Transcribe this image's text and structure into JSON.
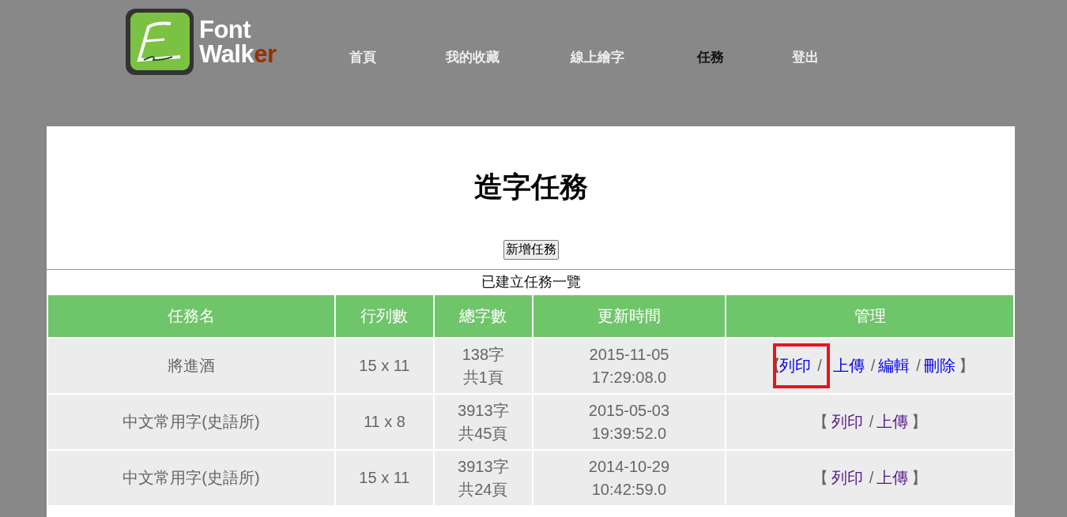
{
  "logo": {
    "line1": "Font",
    "line2": "Walk",
    "line2_accent": "er"
  },
  "nav": [
    {
      "label": "首頁",
      "selected": false
    },
    {
      "label": "我的收藏",
      "selected": false
    },
    {
      "label": "線上繪字",
      "selected": false
    },
    {
      "label": "任務",
      "selected": true
    },
    {
      "label": "登出",
      "selected": false
    }
  ],
  "page_title": "造字任務",
  "add_button": "新增任務",
  "table": {
    "caption": "已建立任務一覽",
    "columns": [
      "任務名",
      "行列數",
      "總字數",
      "更新時間",
      "管理"
    ],
    "rows": [
      {
        "name": "將進酒",
        "grid": "15 x 11",
        "count": [
          "138字",
          "共1頁"
        ],
        "updated": [
          "2015-11-05",
          "17:29:08.0"
        ],
        "open": "【",
        "close": "】",
        "separator": "/",
        "actions": [
          {
            "label": "列印",
            "visited": false,
            "highlighted": true
          },
          {
            "label": "上傳",
            "visited": false,
            "highlighted": false
          },
          {
            "label": "編輯",
            "visited": false,
            "highlighted": false
          },
          {
            "label": "刪除",
            "visited": false,
            "highlighted": false
          }
        ]
      },
      {
        "name": "中文常用字(史語所)",
        "grid": "11 x 8",
        "count": [
          "3913字",
          "共45頁"
        ],
        "updated": [
          "2015-05-03",
          "19:39:52.0"
        ],
        "open": "【",
        "close": "】",
        "separator": "/",
        "actions": [
          {
            "label": "列印",
            "visited": true,
            "highlighted": false
          },
          {
            "label": "上傳",
            "visited": true,
            "highlighted": false
          }
        ]
      },
      {
        "name": "中文常用字(史語所)",
        "grid": "15 x 11",
        "count": [
          "3913字",
          "共24頁"
        ],
        "updated": [
          "2014-10-29",
          "10:42:59.0"
        ],
        "open": "【",
        "close": "】",
        "separator": "/",
        "actions": [
          {
            "label": "列印",
            "visited": true,
            "highlighted": false
          },
          {
            "label": "上傳",
            "visited": true,
            "highlighted": false
          }
        ]
      }
    ]
  }
}
